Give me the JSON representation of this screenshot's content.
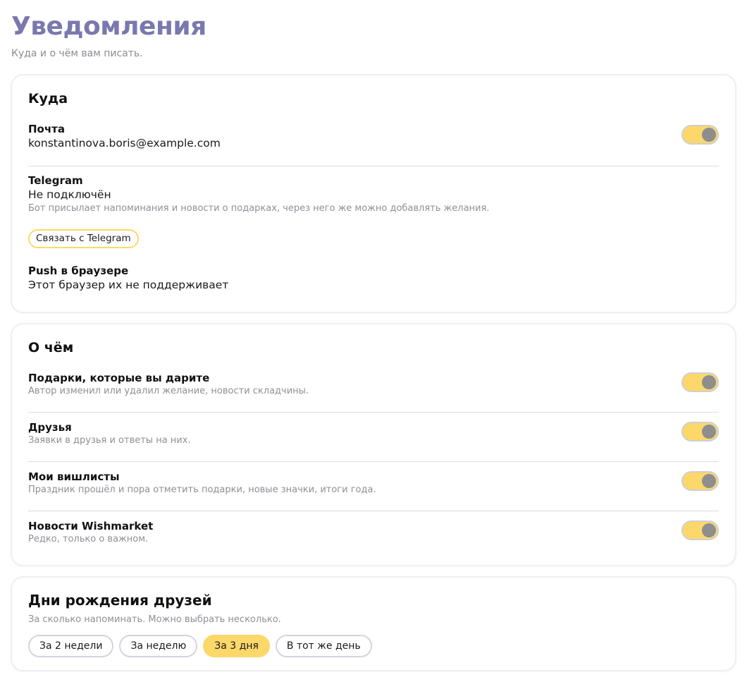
{
  "page": {
    "title": "Уведомления",
    "subtitle": "Куда и о чём вам писать."
  },
  "where": {
    "title": "Куда",
    "email": {
      "title": "Почта",
      "value": "konstantinova.boris@example.com",
      "enabled": true
    },
    "telegram": {
      "title": "Telegram",
      "value": "Не подключён",
      "description": "Бот присылает напоминания и новости о подарках, через него же можно добавлять желания.",
      "button_label": "Связать с Telegram"
    },
    "push": {
      "title": "Push в браузере",
      "value": "Этот браузер их не поддерживает"
    }
  },
  "what": {
    "title": "О чём",
    "items": [
      {
        "title": "Подарки, которые вы дарите",
        "description": "Автор изменил или удалил желание, новости складчины.",
        "enabled": true
      },
      {
        "title": "Друзья",
        "description": "Заявки в друзья и ответы на них.",
        "enabled": true
      },
      {
        "title": "Мои вишлисты",
        "description": "Праздник прошёл и пора отметить подарки, новые значки, итоги года.",
        "enabled": true
      },
      {
        "title": "Новости Wishmarket",
        "description": "Редко, только о важном.",
        "enabled": true
      }
    ]
  },
  "birthdays": {
    "title": "Дни рождения друзей",
    "description": "За сколько напоминать. Можно выбрать несколько.",
    "options": [
      {
        "label": "За 2 недели",
        "selected": false
      },
      {
        "label": "За неделю",
        "selected": false
      },
      {
        "label": "За 3 дня",
        "selected": true
      },
      {
        "label": "В тот же день",
        "selected": false
      }
    ]
  },
  "colors": {
    "title": "#7a78ae",
    "accent": "#fcd86a",
    "knob": "#8e8e8e",
    "muted_text": "#8f8f97"
  }
}
